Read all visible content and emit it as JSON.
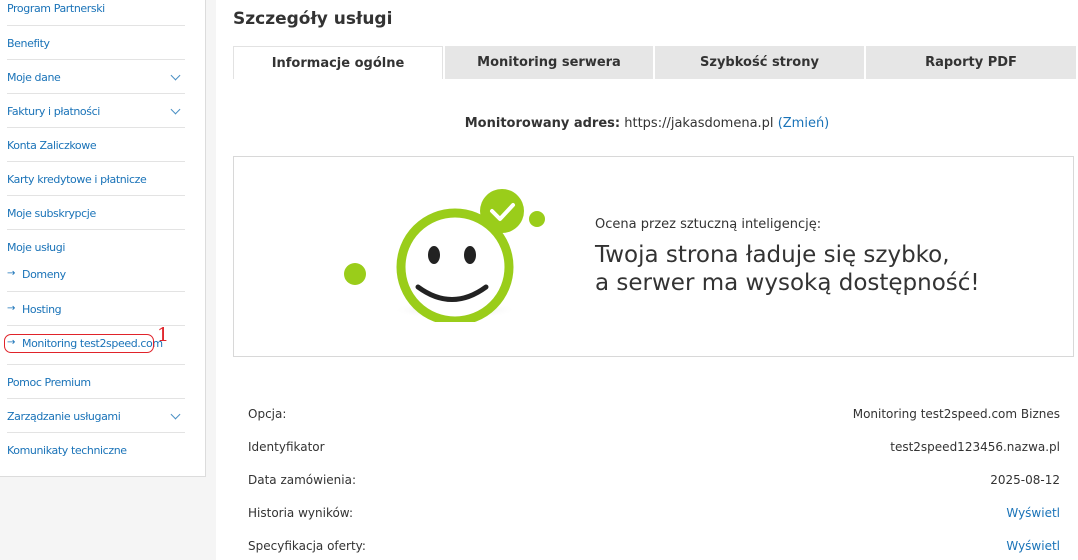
{
  "sidebar": {
    "items": [
      {
        "label": "Program Partnerski"
      },
      {
        "label": "Benefity"
      },
      {
        "label": "Moje dane"
      },
      {
        "label": "Faktury i płatności"
      },
      {
        "label": "Konta Zaliczkowe"
      },
      {
        "label": "Karty kredytowe i płatnicze"
      },
      {
        "label": "Moje subskrypcje"
      },
      {
        "label": "Moje usługi"
      },
      {
        "label": "Domeny"
      },
      {
        "label": "Hosting"
      },
      {
        "label": "Monitoring test2speed.com"
      },
      {
        "label": "Pomoc Premium"
      },
      {
        "label": "Zarządzanie usługami"
      },
      {
        "label": "Komunikaty techniczne"
      }
    ],
    "marker_number": "1"
  },
  "main": {
    "title": "Szczegóły usługi",
    "tabs": [
      {
        "label": "Informacje ogólne",
        "active": true
      },
      {
        "label": "Monitoring serwera"
      },
      {
        "label": "Szybkość strony"
      },
      {
        "label": "Raporty PDF"
      }
    ],
    "monitored": {
      "label": "Monitorowany adres:",
      "url": "https://jakasdomena.pl",
      "change_link": "(Zmień)"
    },
    "ai": {
      "label": "Ocena przez sztuczną inteligencję:",
      "line1": "Twoja strona ładuje się szybko,",
      "line2": "a serwer ma wysoką dostępność!"
    },
    "details": [
      {
        "key": "Opcja:",
        "value": "Monitoring test2speed.com Biznes"
      },
      {
        "key": "Identyfikator",
        "value": "test2speed123456.nazwa.pl"
      },
      {
        "key": "Data zamówienia:",
        "value": "2025-08-12"
      },
      {
        "key": "Historia wyników:",
        "value": "Wyświetl",
        "link": true
      },
      {
        "key": "Specyfikacja oferty:",
        "value": "Wyświetl",
        "link": true
      }
    ]
  },
  "colors": {
    "accent": "#1a73b8",
    "highlight": "#e0232a",
    "smiley_green": "#9acd1a"
  }
}
